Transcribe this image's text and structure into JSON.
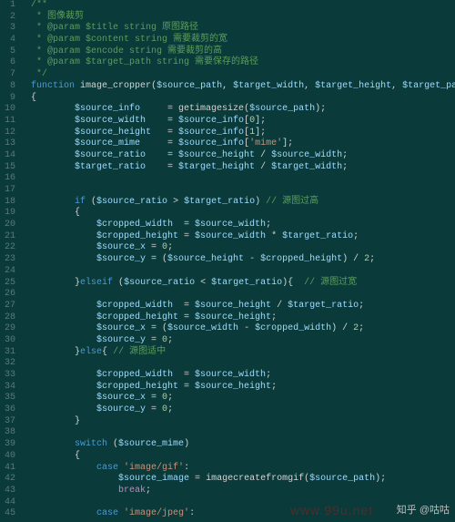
{
  "watermark1": "www.99u.net",
  "watermark2": "知乎 @咕咕",
  "lines": [
    {
      "n": "1",
      "seg": [
        [
          "c-comment",
          "/**"
        ]
      ]
    },
    {
      "n": "2",
      "seg": [
        [
          "c-comment",
          " * 图像裁剪"
        ]
      ]
    },
    {
      "n": "3",
      "seg": [
        [
          "c-comment",
          " * @param $title string 原图路径"
        ]
      ]
    },
    {
      "n": "4",
      "seg": [
        [
          "c-comment",
          " * @param $content string 需要裁剪的宽"
        ]
      ]
    },
    {
      "n": "5",
      "seg": [
        [
          "c-comment",
          " * @param $encode string 需要裁剪的高"
        ]
      ]
    },
    {
      "n": "6",
      "seg": [
        [
          "c-comment",
          " * @param $target_path string 需要保存的路径"
        ]
      ]
    },
    {
      "n": "7",
      "seg": [
        [
          "c-comment",
          " */"
        ]
      ]
    },
    {
      "n": "8",
      "seg": [
        [
          "c-keyword",
          "function"
        ],
        [
          "c-punc",
          " "
        ],
        [
          "c-func",
          "image_cropper"
        ],
        [
          "c-punc",
          "("
        ],
        [
          "c-var",
          "$source_path"
        ],
        [
          "c-punc",
          ", "
        ],
        [
          "c-var",
          "$target_width"
        ],
        [
          "c-punc",
          ", "
        ],
        [
          "c-var",
          "$target_height"
        ],
        [
          "c-punc",
          ", "
        ],
        [
          "c-var",
          "$target_path"
        ],
        [
          "c-punc",
          ")"
        ]
      ]
    },
    {
      "n": "9",
      "seg": [
        [
          "c-punc",
          "{"
        ]
      ]
    },
    {
      "n": "10",
      "i": 2,
      "seg": [
        [
          "c-var",
          "$source_info"
        ],
        [
          "c-punc",
          "     = "
        ],
        [
          "c-func",
          "getimagesize"
        ],
        [
          "c-punc",
          "("
        ],
        [
          "c-var",
          "$source_path"
        ],
        [
          "c-punc",
          ");"
        ]
      ]
    },
    {
      "n": "11",
      "i": 2,
      "seg": [
        [
          "c-var",
          "$source_width"
        ],
        [
          "c-punc",
          "    = "
        ],
        [
          "c-var",
          "$source_info"
        ],
        [
          "c-punc",
          "["
        ],
        [
          "c-num",
          "0"
        ],
        [
          "c-punc",
          "];"
        ]
      ]
    },
    {
      "n": "12",
      "i": 2,
      "seg": [
        [
          "c-var",
          "$source_height"
        ],
        [
          "c-punc",
          "   = "
        ],
        [
          "c-var",
          "$source_info"
        ],
        [
          "c-punc",
          "["
        ],
        [
          "c-num",
          "1"
        ],
        [
          "c-punc",
          "];"
        ]
      ]
    },
    {
      "n": "13",
      "i": 2,
      "seg": [
        [
          "c-var",
          "$source_mime"
        ],
        [
          "c-punc",
          "     = "
        ],
        [
          "c-var",
          "$source_info"
        ],
        [
          "c-punc",
          "["
        ],
        [
          "c-str",
          "'mime'"
        ],
        [
          "c-punc",
          "];"
        ]
      ]
    },
    {
      "n": "14",
      "i": 2,
      "seg": [
        [
          "c-var",
          "$source_ratio"
        ],
        [
          "c-punc",
          "    = "
        ],
        [
          "c-var",
          "$source_height"
        ],
        [
          "c-punc",
          " / "
        ],
        [
          "c-var",
          "$source_width"
        ],
        [
          "c-punc",
          ";"
        ]
      ]
    },
    {
      "n": "15",
      "i": 2,
      "seg": [
        [
          "c-var",
          "$target_ratio"
        ],
        [
          "c-punc",
          "    = "
        ],
        [
          "c-var",
          "$target_height"
        ],
        [
          "c-punc",
          " / "
        ],
        [
          "c-var",
          "$target_width"
        ],
        [
          "c-punc",
          ";"
        ]
      ]
    },
    {
      "n": "16",
      "seg": []
    },
    {
      "n": "17",
      "seg": []
    },
    {
      "n": "18",
      "i": 2,
      "seg": [
        [
          "c-keyword",
          "if"
        ],
        [
          "c-punc",
          " ("
        ],
        [
          "c-var",
          "$source_ratio"
        ],
        [
          "c-punc",
          " > "
        ],
        [
          "c-var",
          "$target_ratio"
        ],
        [
          "c-punc",
          ") "
        ],
        [
          "c-comment",
          "// 源图过高"
        ]
      ]
    },
    {
      "n": "19",
      "i": 2,
      "seg": [
        [
          "c-punc",
          "{"
        ]
      ]
    },
    {
      "n": "20",
      "i": 3,
      "seg": [
        [
          "c-var",
          "$cropped_width"
        ],
        [
          "c-punc",
          "  = "
        ],
        [
          "c-var",
          "$source_width"
        ],
        [
          "c-punc",
          ";"
        ]
      ]
    },
    {
      "n": "21",
      "i": 3,
      "seg": [
        [
          "c-var",
          "$cropped_height"
        ],
        [
          "c-punc",
          " = "
        ],
        [
          "c-var",
          "$source_width"
        ],
        [
          "c-punc",
          " * "
        ],
        [
          "c-var",
          "$target_ratio"
        ],
        [
          "c-punc",
          ";"
        ]
      ]
    },
    {
      "n": "22",
      "i": 3,
      "seg": [
        [
          "c-var",
          "$source_x"
        ],
        [
          "c-punc",
          " = "
        ],
        [
          "c-num",
          "0"
        ],
        [
          "c-punc",
          ";"
        ]
      ]
    },
    {
      "n": "23",
      "i": 3,
      "seg": [
        [
          "c-var",
          "$source_y"
        ],
        [
          "c-punc",
          " = ("
        ],
        [
          "c-var",
          "$source_height"
        ],
        [
          "c-punc",
          " - "
        ],
        [
          "c-var",
          "$cropped_height"
        ],
        [
          "c-punc",
          ") / "
        ],
        [
          "c-num",
          "2"
        ],
        [
          "c-punc",
          ";"
        ]
      ]
    },
    {
      "n": "24",
      "seg": []
    },
    {
      "n": "25",
      "i": 2,
      "seg": [
        [
          "c-punc",
          "}"
        ],
        [
          "c-keyword",
          "elseif"
        ],
        [
          "c-punc",
          " ("
        ],
        [
          "c-var",
          "$source_ratio"
        ],
        [
          "c-punc",
          " < "
        ],
        [
          "c-var",
          "$target_ratio"
        ],
        [
          "c-punc",
          "){  "
        ],
        [
          "c-comment",
          "// 源图过宽"
        ]
      ]
    },
    {
      "n": "26",
      "seg": []
    },
    {
      "n": "27",
      "i": 3,
      "seg": [
        [
          "c-var",
          "$cropped_width"
        ],
        [
          "c-punc",
          "  = "
        ],
        [
          "c-var",
          "$source_height"
        ],
        [
          "c-punc",
          " / "
        ],
        [
          "c-var",
          "$target_ratio"
        ],
        [
          "c-punc",
          ";"
        ]
      ]
    },
    {
      "n": "28",
      "i": 3,
      "seg": [
        [
          "c-var",
          "$cropped_height"
        ],
        [
          "c-punc",
          " = "
        ],
        [
          "c-var",
          "$source_height"
        ],
        [
          "c-punc",
          ";"
        ]
      ]
    },
    {
      "n": "29",
      "i": 3,
      "seg": [
        [
          "c-var",
          "$source_x"
        ],
        [
          "c-punc",
          " = ("
        ],
        [
          "c-var",
          "$source_width"
        ],
        [
          "c-punc",
          " - "
        ],
        [
          "c-var",
          "$cropped_width"
        ],
        [
          "c-punc",
          ") / "
        ],
        [
          "c-num",
          "2"
        ],
        [
          "c-punc",
          ";"
        ]
      ]
    },
    {
      "n": "30",
      "i": 3,
      "seg": [
        [
          "c-var",
          "$source_y"
        ],
        [
          "c-punc",
          " = "
        ],
        [
          "c-num",
          "0"
        ],
        [
          "c-punc",
          ";"
        ]
      ]
    },
    {
      "n": "31",
      "i": 2,
      "seg": [
        [
          "c-punc",
          "}"
        ],
        [
          "c-keyword",
          "else"
        ],
        [
          "c-punc",
          "{ "
        ],
        [
          "c-comment",
          "// 源图适中"
        ]
      ]
    },
    {
      "n": "32",
      "seg": []
    },
    {
      "n": "33",
      "i": 3,
      "seg": [
        [
          "c-var",
          "$cropped_width"
        ],
        [
          "c-punc",
          "  = "
        ],
        [
          "c-var",
          "$source_width"
        ],
        [
          "c-punc",
          ";"
        ]
      ]
    },
    {
      "n": "34",
      "i": 3,
      "seg": [
        [
          "c-var",
          "$cropped_height"
        ],
        [
          "c-punc",
          " = "
        ],
        [
          "c-var",
          "$source_height"
        ],
        [
          "c-punc",
          ";"
        ]
      ]
    },
    {
      "n": "35",
      "i": 3,
      "seg": [
        [
          "c-var",
          "$source_x"
        ],
        [
          "c-punc",
          " = "
        ],
        [
          "c-num",
          "0"
        ],
        [
          "c-punc",
          ";"
        ]
      ]
    },
    {
      "n": "36",
      "i": 3,
      "seg": [
        [
          "c-var",
          "$source_y"
        ],
        [
          "c-punc",
          " = "
        ],
        [
          "c-num",
          "0"
        ],
        [
          "c-punc",
          ";"
        ]
      ]
    },
    {
      "n": "37",
      "i": 2,
      "seg": [
        [
          "c-punc",
          "}"
        ]
      ]
    },
    {
      "n": "38",
      "seg": []
    },
    {
      "n": "39",
      "i": 2,
      "seg": [
        [
          "c-keyword",
          "switch"
        ],
        [
          "c-punc",
          " ("
        ],
        [
          "c-var",
          "$source_mime"
        ],
        [
          "c-punc",
          ")"
        ]
      ]
    },
    {
      "n": "40",
      "i": 2,
      "seg": [
        [
          "c-punc",
          "{"
        ]
      ]
    },
    {
      "n": "41",
      "i": 3,
      "seg": [
        [
          "c-keyword",
          "case"
        ],
        [
          "c-punc",
          " "
        ],
        [
          "c-str",
          "'image/gif'"
        ],
        [
          "c-punc",
          ":"
        ]
      ]
    },
    {
      "n": "42",
      "i": 4,
      "seg": [
        [
          "c-var",
          "$source_image"
        ],
        [
          "c-punc",
          " = "
        ],
        [
          "c-func",
          "imagecreatefromgif"
        ],
        [
          "c-punc",
          "("
        ],
        [
          "c-var",
          "$source_path"
        ],
        [
          "c-punc",
          ");"
        ]
      ]
    },
    {
      "n": "43",
      "i": 4,
      "seg": [
        [
          "c-break",
          "break"
        ],
        [
          "c-punc",
          ";"
        ]
      ]
    },
    {
      "n": "44",
      "seg": []
    },
    {
      "n": "45",
      "i": 3,
      "seg": [
        [
          "c-keyword",
          "case"
        ],
        [
          "c-punc",
          " "
        ],
        [
          "c-str",
          "'image/jpeg'"
        ],
        [
          "c-punc",
          ":"
        ]
      ]
    }
  ]
}
